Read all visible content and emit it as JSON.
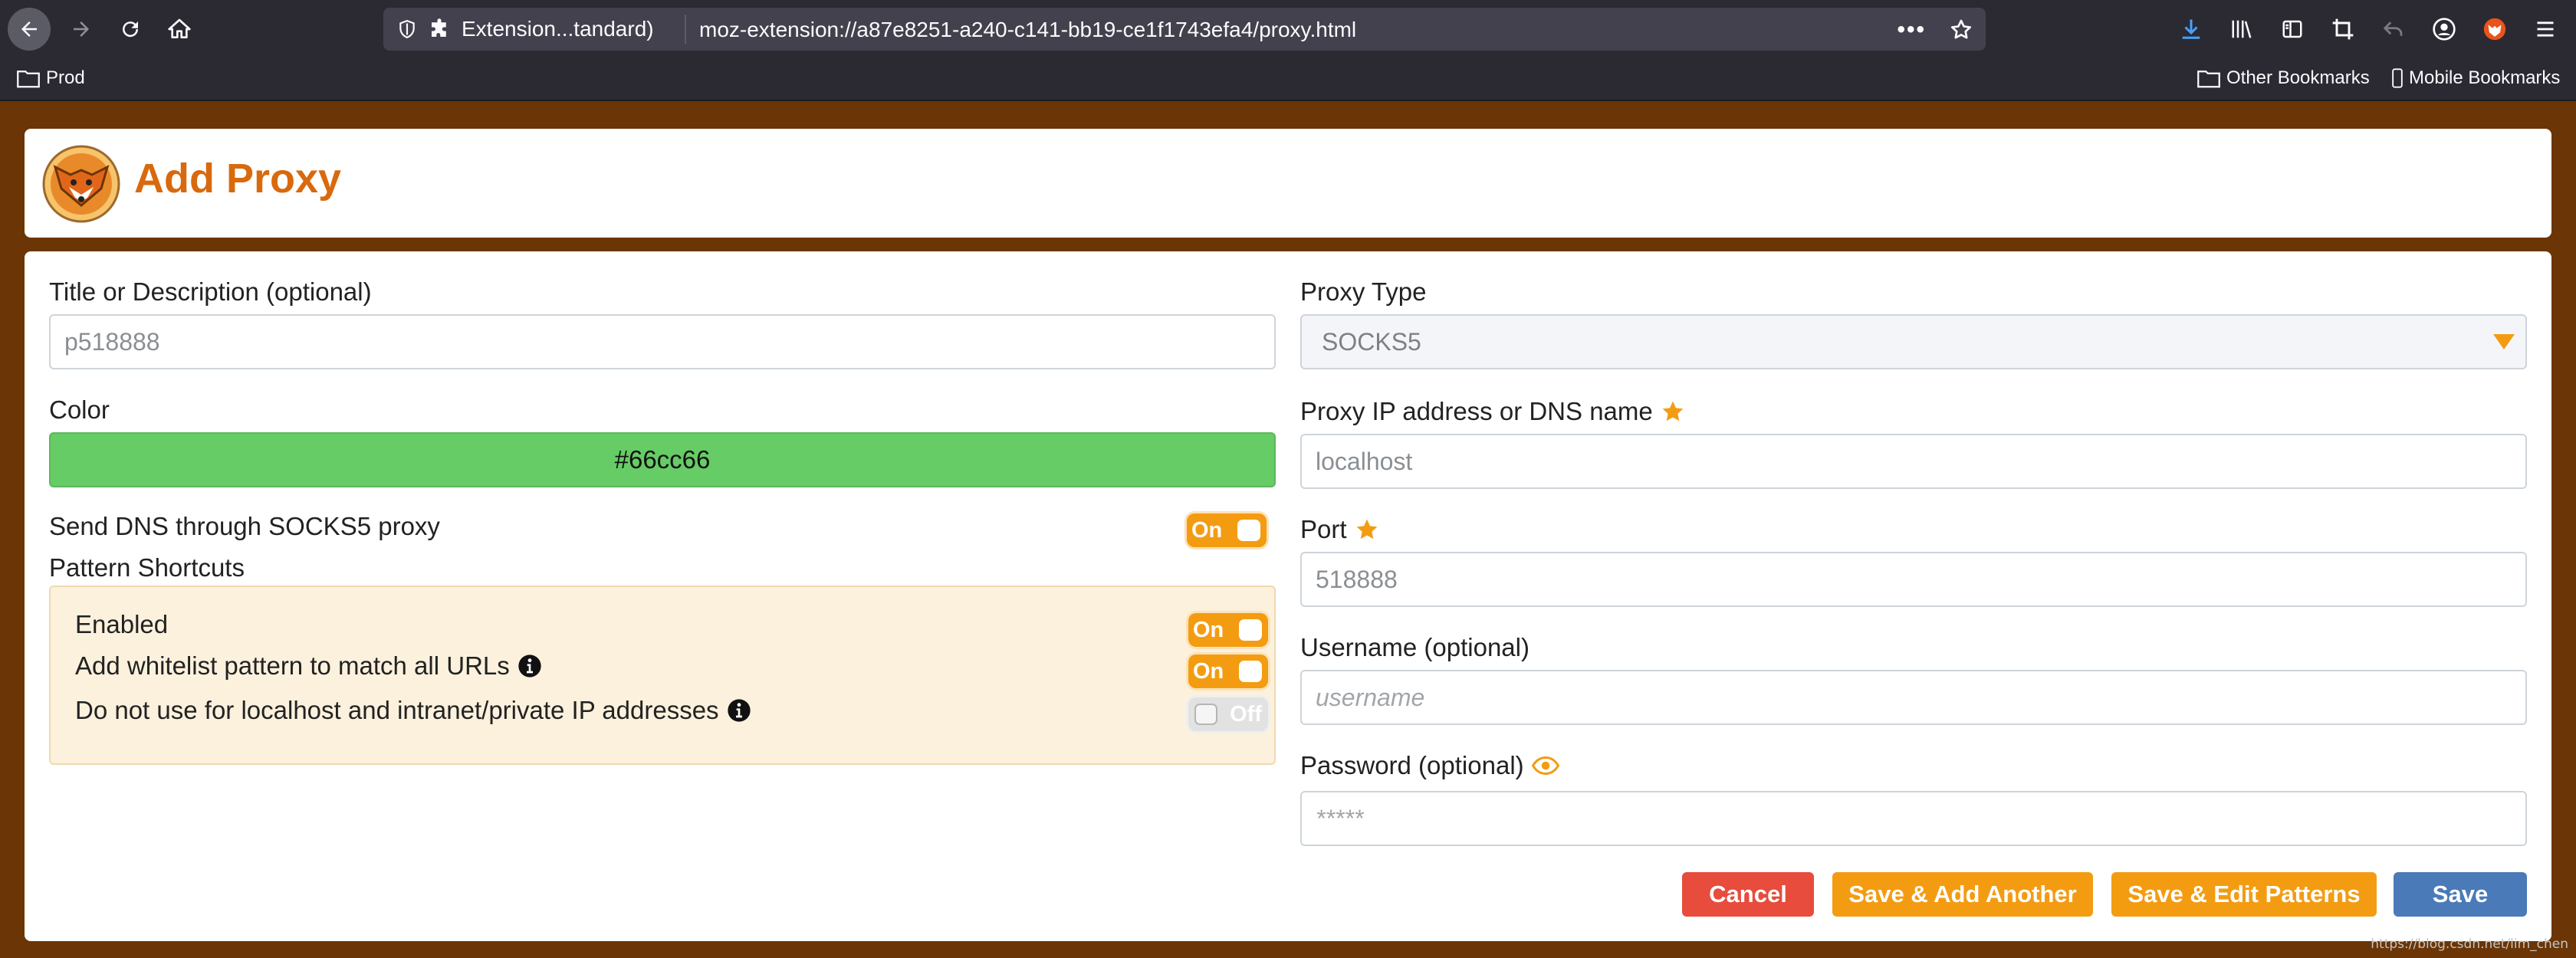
{
  "browser": {
    "url_identity_label": "Extension...tandard)",
    "url": "moz-extension://a87e8251-a240-c141-bb19-ce1f1743efa4/proxy.html",
    "bookmarks": {
      "left": "Prod",
      "other": "Other Bookmarks",
      "mobile": "Mobile Bookmarks"
    }
  },
  "header": {
    "title": "Add Proxy"
  },
  "form": {
    "title_label": "Title or Description (optional)",
    "title_placeholder": "p518888",
    "color_label": "Color",
    "color_value": "#66cc66",
    "dns_label": "Send DNS through SOCKS5 proxy",
    "dns_toggle": "On",
    "pattern_shortcuts_label": "Pattern Shortcuts",
    "patterns": [
      {
        "label": "Enabled",
        "state": "On"
      },
      {
        "label": "Add whitelist pattern to match all URLs",
        "state": "On"
      },
      {
        "label": "Do not use for localhost and intranet/private IP addresses",
        "state": "Off"
      }
    ],
    "proxy_type_label": "Proxy Type",
    "proxy_type_value": "SOCKS5",
    "ip_label": "Proxy IP address or DNS name",
    "ip_placeholder": "localhost",
    "port_label": "Port",
    "port_placeholder": "518888",
    "username_label": "Username (optional)",
    "username_placeholder": "username",
    "password_label": "Password (optional)",
    "password_placeholder": "*****"
  },
  "buttons": {
    "cancel": "Cancel",
    "save_add_another": "Save & Add Another",
    "save_edit_patterns": "Save & Edit Patterns",
    "save": "Save"
  },
  "watermark": "https://blog.csdn.net/lim_chen",
  "colors": {
    "page_background": "#6b3505",
    "accent_orange": "#f39c12",
    "title_orange": "#d9690d",
    "cancel_red": "#e74c3c",
    "save_blue": "#4a7ab8",
    "color_swatch": "#66cc66",
    "pattern_box_bg": "#fcf1dd"
  }
}
